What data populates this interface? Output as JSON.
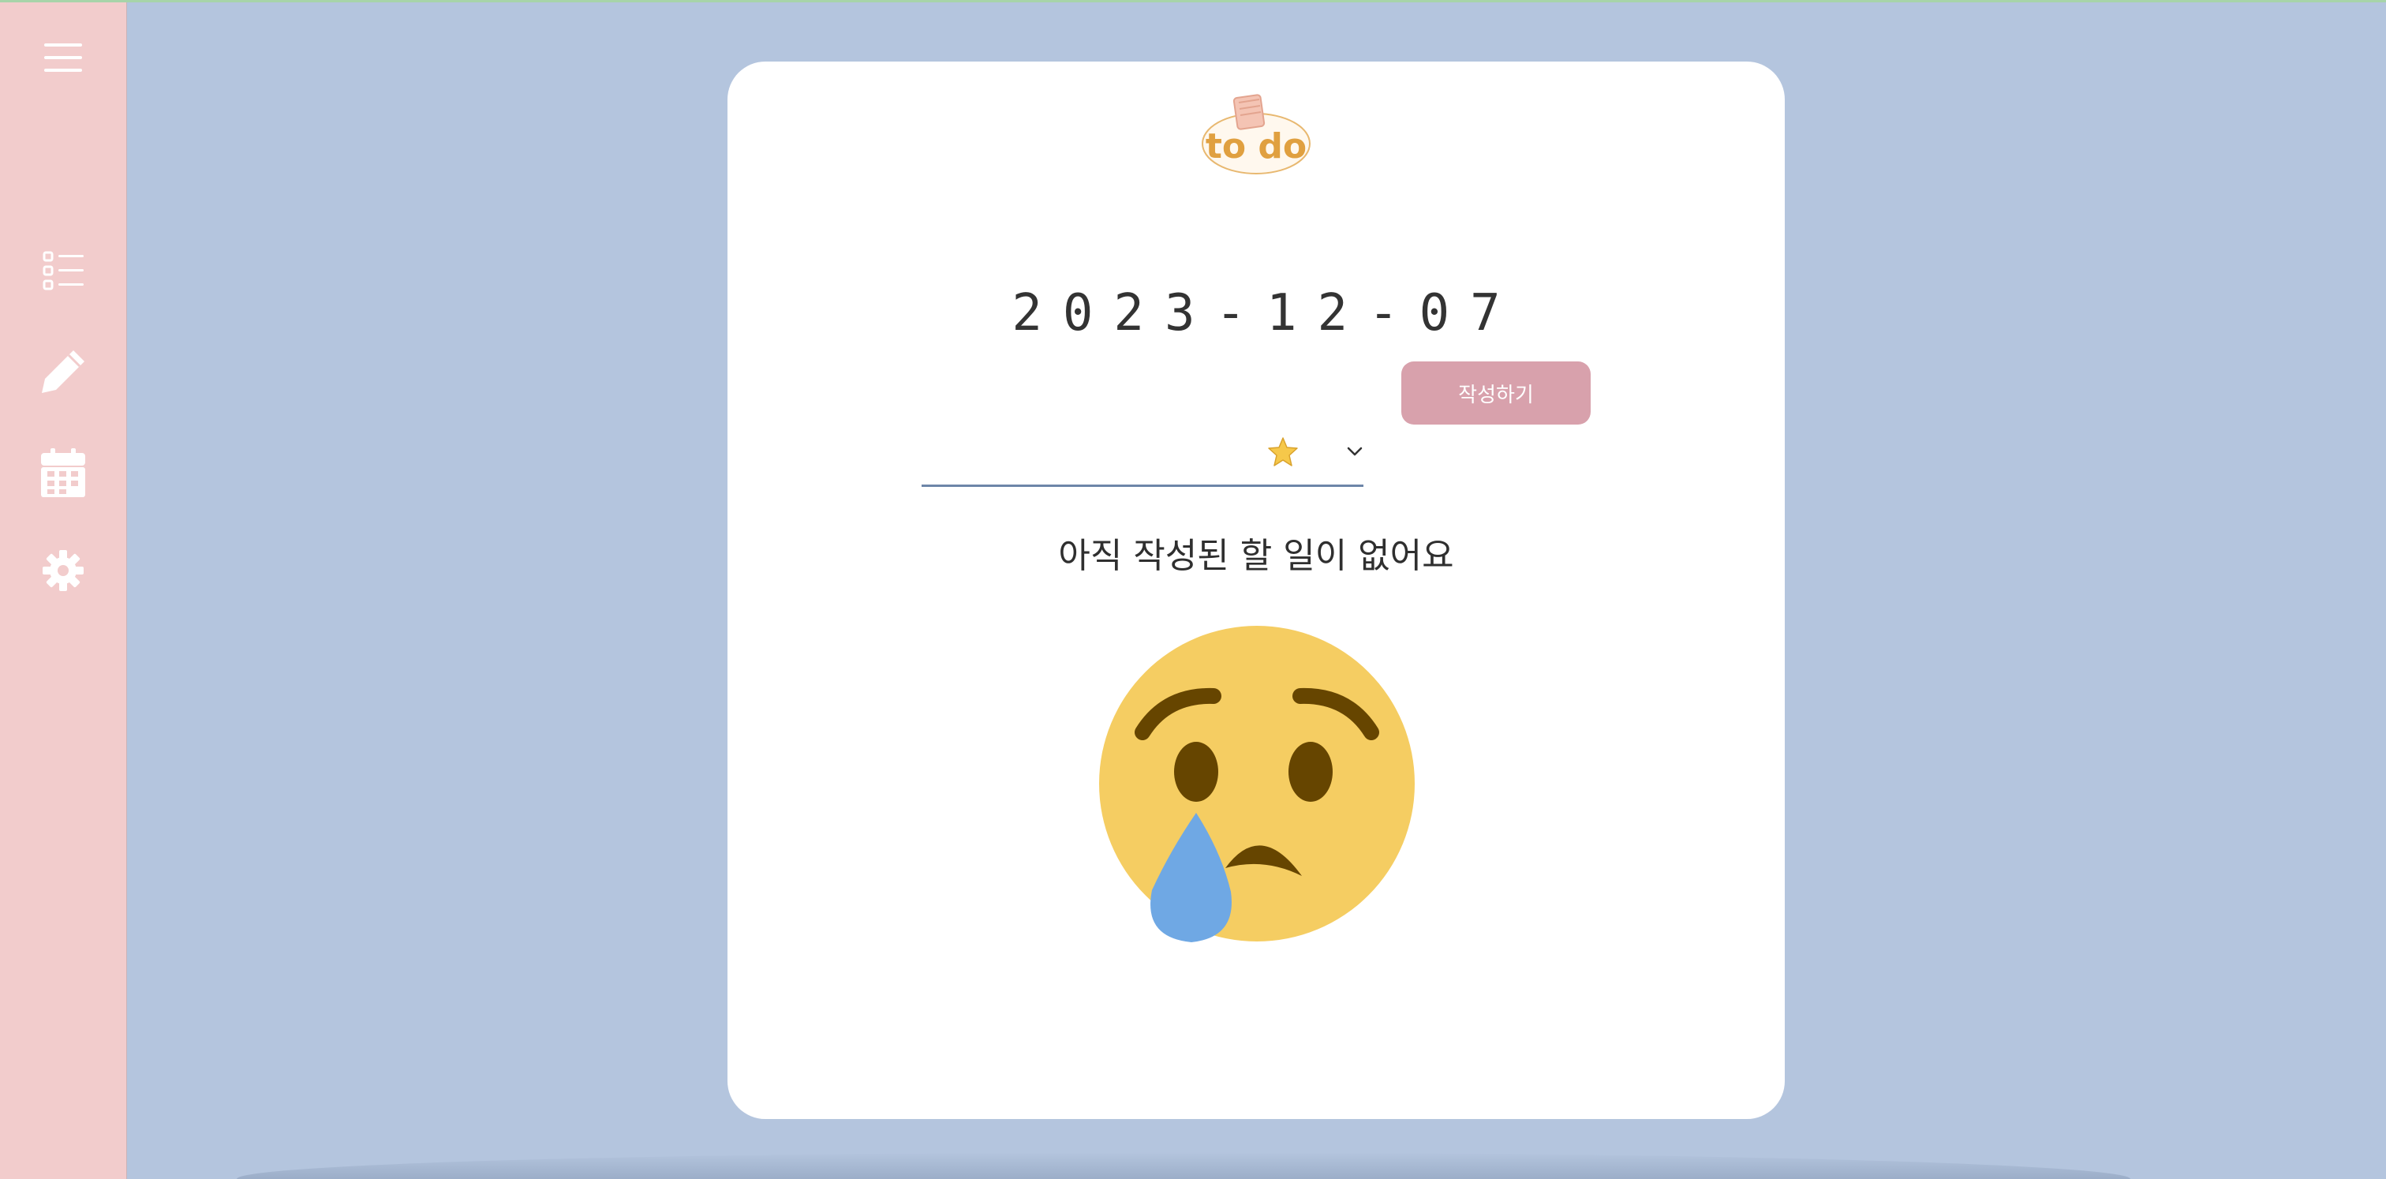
{
  "app": {
    "logo_text": "to do"
  },
  "sidebar": {
    "items": [
      {
        "icon": "menu-icon"
      },
      {
        "icon": "list-icon"
      },
      {
        "icon": "pencil-icon"
      },
      {
        "icon": "calendar-icon"
      },
      {
        "icon": "gear-icon"
      }
    ]
  },
  "main": {
    "date": "2023-12-07",
    "input": {
      "value": "",
      "placeholder": ""
    },
    "priority": {
      "selected_icon": "star-icon",
      "selected_value": "⭐"
    },
    "submit_label": "작성하기",
    "empty_message": "아직 작성된 할 일이 없어요",
    "empty_icon": "crying-face-icon"
  },
  "colors": {
    "background": "#b4c5de",
    "sidebar": "#f2cccc",
    "card": "#ffffff",
    "button": "#d8a1ac",
    "input_underline": "#6d86a8",
    "logo": "#e0a040"
  }
}
